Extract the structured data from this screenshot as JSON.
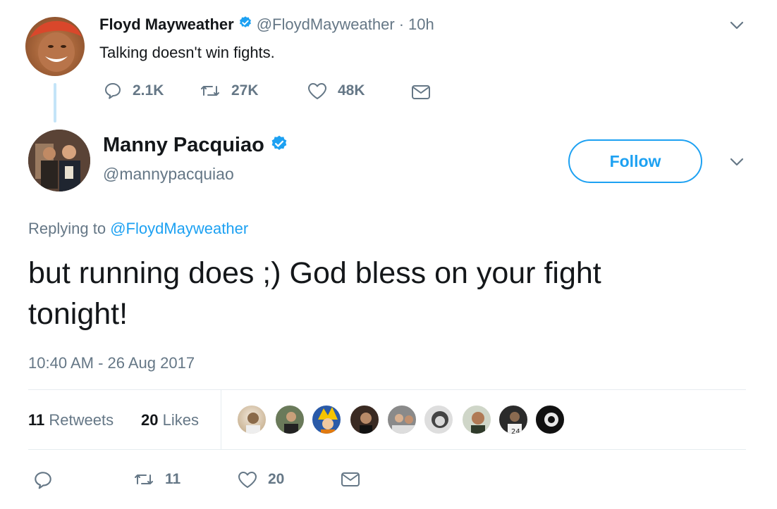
{
  "parent_tweet": {
    "name": "Floyd Mayweather",
    "handle": "@FloydMayweather",
    "separator": "·",
    "time": "10h",
    "text": "Talking doesn't win fights.",
    "replies": "2.1K",
    "retweets": "27K",
    "likes": "48K"
  },
  "reply_tweet": {
    "name": "Manny Pacquiao",
    "handle": "@mannypacquiao",
    "follow_label": "Follow",
    "replying_prefix": "Replying to",
    "replying_handle": "@FloydMayweather",
    "text_line1": "but running does ;) God bless on your fight",
    "text_line2": "tonight!",
    "timestamp": "10:40 AM - 26 Aug 2017",
    "retweet_count": "11",
    "retweet_label": "Retweets",
    "like_count": "20",
    "like_label": "Likes",
    "action_retweets": "11",
    "action_likes": "20"
  },
  "colors": {
    "accent": "#1da1f2",
    "muted": "#657786",
    "divider": "#e6ecf0",
    "thread_line": "#c4e4f8"
  },
  "icons": [
    "reply-icon",
    "retweet-icon",
    "heart-icon",
    "message-icon",
    "chevron-down-icon",
    "verified-badge-icon"
  ]
}
